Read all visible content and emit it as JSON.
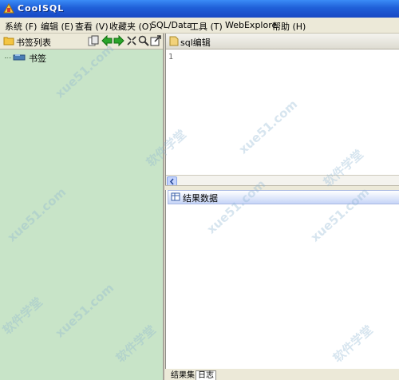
{
  "window": {
    "title": "CoolSQL"
  },
  "menu": {
    "items": [
      "系统 (F)",
      "编辑 (E)",
      "查看 (V)",
      "收藏夹 (O)",
      "SQL/Data",
      "工具 (T)",
      "WebExplore",
      "帮助 (H)"
    ]
  },
  "left_panel": {
    "title": "书签列表",
    "toolbar_icons": [
      "copy-icon",
      "arrow-left-icon",
      "arrow-right-icon",
      "collapse-icon",
      "search-icon",
      "external-link-icon"
    ],
    "tree": [
      {
        "label": "书签"
      }
    ]
  },
  "sql_editor": {
    "title": "sql编辑",
    "line_numbers": [
      "1"
    ]
  },
  "result_panel": {
    "title": "结果数据"
  },
  "bottom_tabs": [
    "结果集",
    "日志"
  ],
  "watermark": {
    "chars": "软件学堂",
    "url": "xue51.com"
  },
  "colors": {
    "left_panel_bg": "#c8e4c8",
    "titlebar": "#1f5fd8"
  }
}
